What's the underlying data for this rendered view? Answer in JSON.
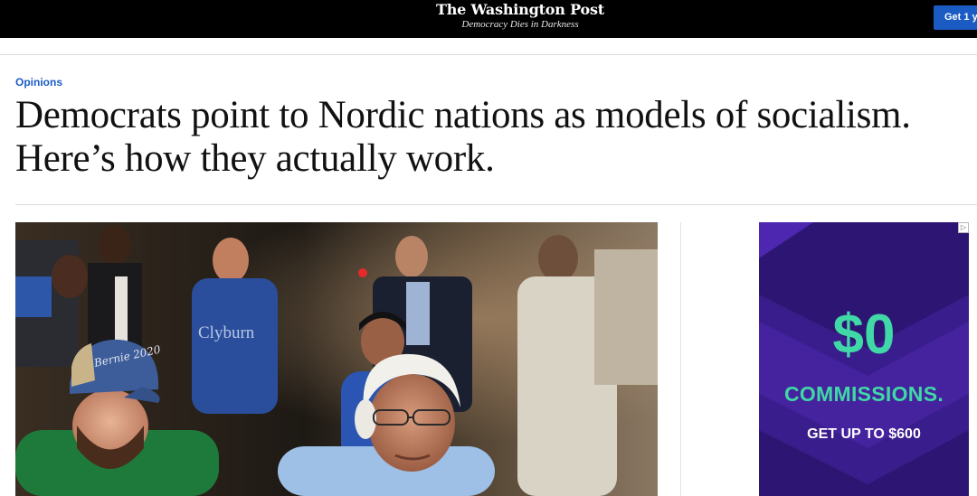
{
  "topbar": {
    "logo_text": "The Washington Post",
    "tagline": "Democracy Dies in Darkness",
    "subscribe_label": "Get 1 y",
    "background_color": "#000000",
    "button_color": "#1b5cc4"
  },
  "article": {
    "section_label": "Opinions",
    "headline": "Democrats point to Nordic nations as models of socialism. Here’s how they actually work.",
    "accent_color": "#1b5cc4"
  },
  "photo": {
    "cap_text": "Bernie 2020",
    "shirt_text": "Clyburn",
    "background_shirt_text": "lybur"
  },
  "ad": {
    "big_text": "$0",
    "commission_text": "COMMISSIONS.",
    "offer_text": "GET UP TO $600",
    "icon": "adchoices-icon",
    "text_color": "#3fd8a6",
    "background_color": "#3a1d8c"
  }
}
